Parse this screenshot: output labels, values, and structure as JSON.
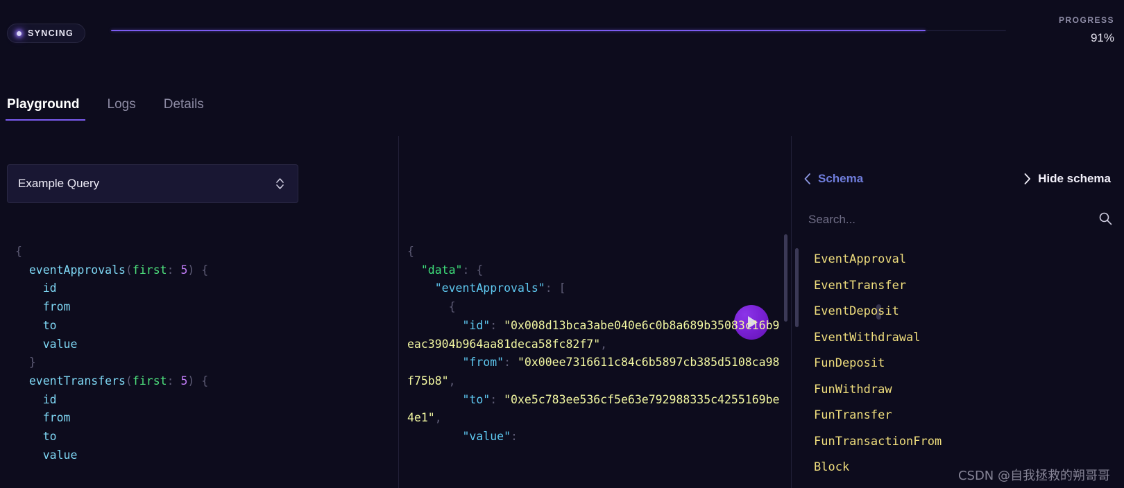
{
  "status": {
    "badge_label": "SYNCING",
    "progress_label": "PROGRESS",
    "progress_value": "91%",
    "progress_percent": 91,
    "accent_color": "#7b5cf0"
  },
  "tabs": [
    {
      "label": "Playground",
      "active": true
    },
    {
      "label": "Logs",
      "active": false
    },
    {
      "label": "Details",
      "active": false
    }
  ],
  "editor": {
    "query_selector_value": "Example Query",
    "selector_icon": "chevron-up-down-icon",
    "run_icon": "play-icon",
    "query_lines": [
      [
        {
          "t": "punc",
          "v": "{"
        }
      ],
      [
        {
          "t": "plain",
          "v": "  "
        },
        {
          "t": "field",
          "v": "eventApprovals"
        },
        {
          "t": "punc",
          "v": "("
        },
        {
          "t": "arg",
          "v": "first"
        },
        {
          "t": "punc",
          "v": ": "
        },
        {
          "t": "num",
          "v": "5"
        },
        {
          "t": "punc",
          "v": ") {"
        }
      ],
      [
        {
          "t": "plain",
          "v": "    "
        },
        {
          "t": "field",
          "v": "id"
        }
      ],
      [
        {
          "t": "plain",
          "v": "    "
        },
        {
          "t": "field",
          "v": "from"
        }
      ],
      [
        {
          "t": "plain",
          "v": "    "
        },
        {
          "t": "field",
          "v": "to"
        }
      ],
      [
        {
          "t": "plain",
          "v": "    "
        },
        {
          "t": "field",
          "v": "value"
        }
      ],
      [
        {
          "t": "punc",
          "v": "  }"
        }
      ],
      [
        {
          "t": "plain",
          "v": "  "
        },
        {
          "t": "field",
          "v": "eventTransfers"
        },
        {
          "t": "punc",
          "v": "("
        },
        {
          "t": "arg",
          "v": "first"
        },
        {
          "t": "punc",
          "v": ": "
        },
        {
          "t": "num",
          "v": "5"
        },
        {
          "t": "punc",
          "v": ") {"
        }
      ],
      [
        {
          "t": "plain",
          "v": "    "
        },
        {
          "t": "field",
          "v": "id"
        }
      ],
      [
        {
          "t": "plain",
          "v": "    "
        },
        {
          "t": "field",
          "v": "from"
        }
      ],
      [
        {
          "t": "plain",
          "v": "    "
        },
        {
          "t": "field",
          "v": "to"
        }
      ],
      [
        {
          "t": "plain",
          "v": "    "
        },
        {
          "t": "field",
          "v": "value"
        }
      ]
    ]
  },
  "result": {
    "lines": [
      [
        {
          "t": "punc",
          "v": "{"
        }
      ],
      [
        {
          "t": "plain",
          "v": "  "
        },
        {
          "t": "keytop",
          "v": "\"data\""
        },
        {
          "t": "punc",
          "v": ": {"
        }
      ],
      [
        {
          "t": "plain",
          "v": "    "
        },
        {
          "t": "key",
          "v": "\"eventApprovals\""
        },
        {
          "t": "punc",
          "v": ": ["
        }
      ],
      [
        {
          "t": "punc",
          "v": "      {"
        }
      ],
      [
        {
          "t": "plain",
          "v": "        "
        },
        {
          "t": "key",
          "v": "\"id\""
        },
        {
          "t": "punc",
          "v": ": "
        },
        {
          "t": "str",
          "v": "\"0x008d13bca3abe040e6c0b8a689b35083c16b9eac3904b964aa81deca58fc82f7\""
        },
        {
          "t": "punc",
          "v": ","
        }
      ],
      [
        {
          "t": "plain",
          "v": "        "
        },
        {
          "t": "key",
          "v": "\"from\""
        },
        {
          "t": "punc",
          "v": ": "
        },
        {
          "t": "str",
          "v": "\"0x00ee7316611c84c6b5897cb385d5108ca98f75b8\""
        },
        {
          "t": "punc",
          "v": ","
        }
      ],
      [
        {
          "t": "plain",
          "v": "        "
        },
        {
          "t": "key",
          "v": "\"to\""
        },
        {
          "t": "punc",
          "v": ": "
        },
        {
          "t": "str",
          "v": "\"0xe5c783ee536cf5e63e792988335c4255169be4e1\""
        },
        {
          "t": "punc",
          "v": ","
        }
      ],
      [
        {
          "t": "plain",
          "v": "        "
        },
        {
          "t": "key",
          "v": "\"value\""
        },
        {
          "t": "punc",
          "v": ": "
        }
      ]
    ]
  },
  "schema": {
    "back_label": "Schema",
    "back_icon": "chevron-left-icon",
    "hide_label": "Hide schema",
    "hide_icon": "chevron-right-icon",
    "search_placeholder": "Search...",
    "search_value": "",
    "search_icon": "search-icon",
    "types": [
      "EventApproval",
      "EventTransfer",
      "EventDeposit",
      "EventWithdrawal",
      "FunDeposit",
      "FunWithdraw",
      "FunTransfer",
      "FunTransactionFrom",
      "Block"
    ]
  },
  "watermark": {
    "text": "CSDN @自我拯救的朔哥哥"
  }
}
